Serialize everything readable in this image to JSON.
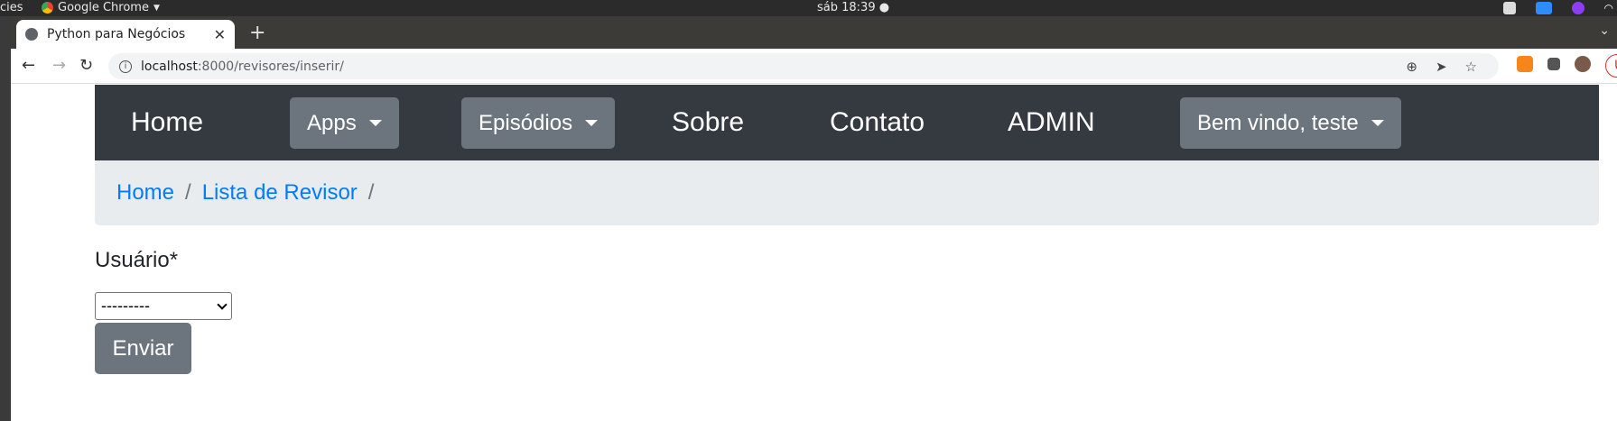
{
  "os_bar": {
    "activities": "cies",
    "app_name": "Google Chrome",
    "clock": "sáb 18:39 ●"
  },
  "browser": {
    "tab_title": "Python para Negócios",
    "tab_close": "✕",
    "new_tab": "+",
    "url_host": "localhost",
    "url_path": ":8000/revisores/inserir/",
    "update_label": "Up"
  },
  "navbar": {
    "home": "Home",
    "apps": "Apps",
    "episodios": "Episódios",
    "sobre": "Sobre",
    "contato": "Contato",
    "admin": "ADMIN",
    "user_menu": "Bem vindo, teste"
  },
  "breadcrumb": {
    "items": [
      "Home",
      "Lista de Revisor"
    ],
    "separator": "/"
  },
  "form": {
    "label": "Usuário*",
    "select_value": "---------",
    "submit": "Enviar"
  },
  "colors": {
    "navbar_bg": "#343a40",
    "button_bg": "#6c757d",
    "link": "#007bff",
    "breadcrumb_bg": "#e9ecef"
  }
}
